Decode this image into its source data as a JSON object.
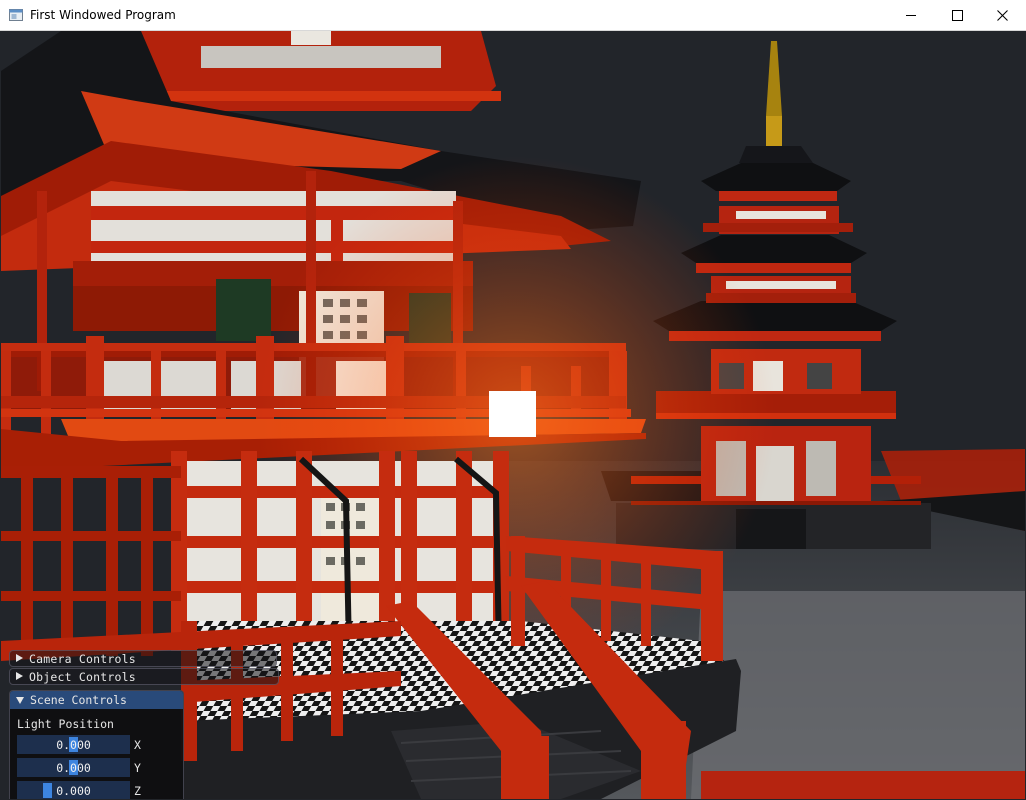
{
  "window": {
    "title": "First Windowed Program",
    "controls": [
      "minimize",
      "maximize",
      "close"
    ]
  },
  "ui": {
    "camera_controls": {
      "label": "Camera Controls",
      "expanded": false
    },
    "object_controls": {
      "label": "Object Controls",
      "expanded": false
    },
    "scene_controls": {
      "label": "Scene Controls",
      "expanded": true,
      "light_position_label": "Light Position",
      "sliders": [
        {
          "axis": "X",
          "value": "0.000",
          "level": 0.5
        },
        {
          "axis": "Y",
          "value": "0.000",
          "level": 0.5
        },
        {
          "axis": "Z",
          "value": "0.000",
          "level": 0.25
        }
      ]
    }
  },
  "colors": {
    "titlebar_bg": "#ffffff",
    "scene_background": "#22252a",
    "pagoda_red": "#c41e06",
    "panel_title": "#294a7a",
    "slider_bg": "#1d2f4d",
    "slider_grab": "#3d85e0"
  }
}
